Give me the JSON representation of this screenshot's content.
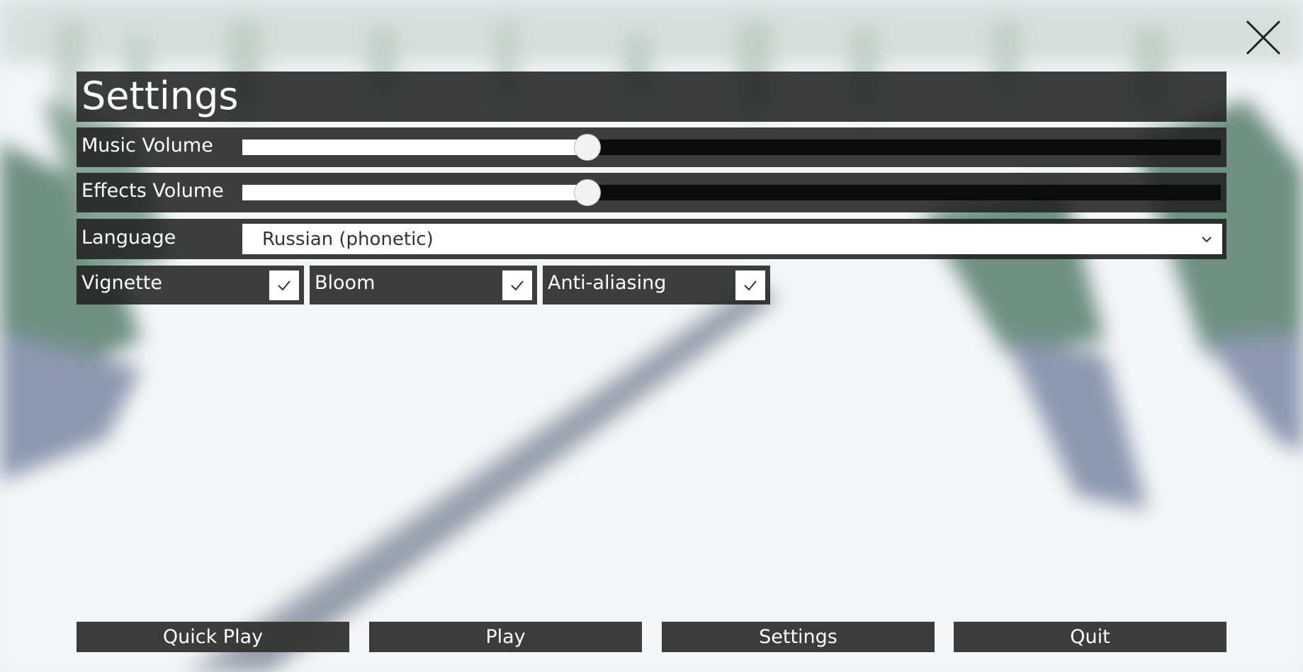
{
  "window": {
    "close_icon": "close-icon"
  },
  "settings": {
    "title": "Settings",
    "music_volume": {
      "label": "Music Volume",
      "value_fraction": 0.353
    },
    "effects_volume": {
      "label": "Effects Volume",
      "value_fraction": 0.353
    },
    "language": {
      "label": "Language",
      "value": "Russian (phonetic)",
      "chevron_icon": "chevron-down-icon"
    },
    "toggles": [
      {
        "label": "Vignette",
        "checked": true
      },
      {
        "label": "Bloom",
        "checked": true
      },
      {
        "label": "Anti-aliasing",
        "checked": true
      }
    ]
  },
  "menu": {
    "quick_play": "Quick Play",
    "play": "Play",
    "settings": "Settings",
    "quit": "Quit"
  },
  "colors": {
    "panel": "#1e1e1e",
    "button": "#343434",
    "text": "#ffffff",
    "track_empty": "#0b0b0b",
    "track_fill": "#ffffff"
  }
}
